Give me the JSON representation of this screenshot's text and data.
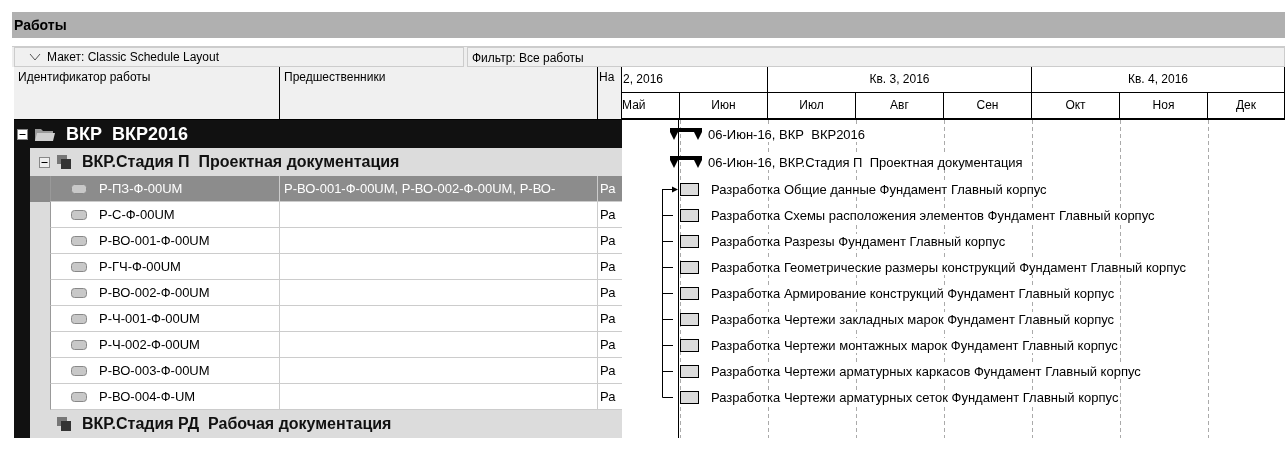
{
  "title": "Работы",
  "toolbar": {
    "layout": "Макет: Classic Schedule Layout",
    "filter": "Фильтр: Все работы"
  },
  "columns": [
    "Идентификатор работы",
    "Предшественники",
    "На"
  ],
  "timescale": [
    {
      "label": "2, 2016",
      "months": [
        "Май",
        "Июн"
      ]
    },
    {
      "label": "Кв. 3, 2016",
      "months": [
        "Июл",
        "Авг",
        "Сен"
      ]
    },
    {
      "label": "Кв. 4, 2016",
      "months": [
        "Окт",
        "Ноя",
        "Дек"
      ]
    }
  ],
  "tree": [
    {
      "kind": "wbs",
      "name": "ВКР  ВКР2016",
      "bar_label": "06-Июн-16, ВКР  ВКР2016",
      "expanded": true,
      "children": [
        {
          "kind": "wbs",
          "name": "ВКР.Стадия П  Проектная документация",
          "bar_label": "06-Июн-16, ВКР.Стадия П  Проектная документация",
          "expanded": true,
          "children": [
            {
              "kind": "activity",
              "id": "Р-ПЗ-Ф-00UM",
              "predecessors": "Р-ВО-001-Ф-00UM, Р-ВО-002-Ф-00UM, Р-ВО-",
              "column_3": "Ра",
              "bar_label": "Разработка Общие данные Фундамент Главный корпус",
              "selected": true
            },
            {
              "kind": "activity",
              "id": "Р-С-Ф-00UM",
              "column_3": "Ра",
              "bar_label": "Разработка Схемы расположения элементов Фундамент Главный корпус",
              "selected": false
            },
            {
              "kind": "activity",
              "id": "Р-ВО-001-Ф-00UM",
              "column_3": "Ра",
              "bar_label": "Разработка Разрезы Фундамент Главный корпус",
              "selected": false
            },
            {
              "kind": "activity",
              "id": "Р-ГЧ-Ф-00UM",
              "column_3": "Ра",
              "bar_label": "Разработка Геометрические размеры конструкций Фундамент Главный корпус",
              "selected": false
            },
            {
              "kind": "activity",
              "id": "Р-ВО-002-Ф-00UM",
              "column_3": "Ра",
              "bar_label": "Разработка Армирование конструкций Фундамент Главный корпус",
              "selected": false
            },
            {
              "kind": "activity",
              "id": "Р-Ч-001-Ф-00UM",
              "column_3": "Ра",
              "bar_label": "Разработка Чертежи закладных марок Фундамент Главный корпус",
              "selected": false
            },
            {
              "kind": "activity",
              "id": "Р-Ч-002-Ф-00UM",
              "column_3": "Ра",
              "bar_label": "Разработка Чертежи монтажных марок Фундамент Главный корпус",
              "selected": false
            },
            {
              "kind": "activity",
              "id": "Р-ВО-003-Ф-00UM",
              "column_3": "Ра",
              "bar_label": "Разработка Чертежи арматурных каркасов Фундамент Главный корпус",
              "selected": false
            },
            {
              "kind": "activity",
              "id": "Р-ВО-004-Ф-UM",
              "column_3": "Ра",
              "bar_label": "Разработка Чертежи арматурных сеток Фундамент Главный корпус",
              "selected": false
            }
          ]
        },
        {
          "kind": "wbs",
          "name": "ВКР.Стадия РД  Рабочая документация",
          "expanded": false
        }
      ]
    }
  ]
}
